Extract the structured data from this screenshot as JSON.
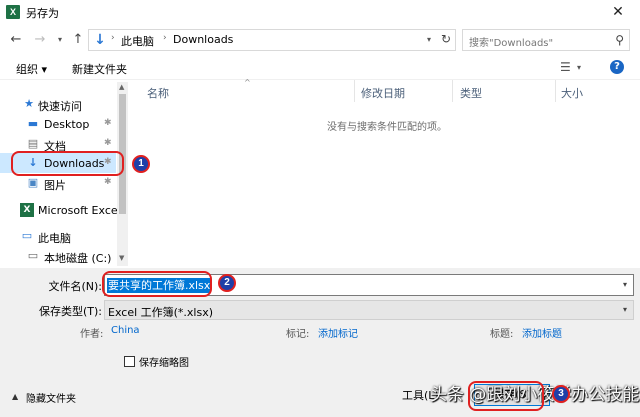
{
  "window": {
    "title": "另存为",
    "app_icon": "excel-icon",
    "close_glyph": "✕"
  },
  "address": {
    "crumbs": [
      "此电脑",
      "Downloads"
    ],
    "search_placeholder": "搜索\"Downloads\""
  },
  "toolbar": {
    "organize": "组织 ▾",
    "new_folder": "新建文件夹",
    "help": "?"
  },
  "nav": {
    "items": [
      {
        "label": "快速访问",
        "icon": "star-icon"
      },
      {
        "label": "Desktop",
        "icon": "desktop-folder-icon"
      },
      {
        "label": "文档",
        "icon": "documents-icon"
      },
      {
        "label": "Downloads",
        "icon": "download-arrow-icon"
      },
      {
        "label": "图片",
        "icon": "pictures-icon"
      },
      {
        "label": "Microsoft Excel",
        "icon": "excel-icon"
      },
      {
        "label": "此电脑",
        "icon": "computer-icon"
      },
      {
        "label": "本地磁盘 (C:)",
        "icon": "drive-icon"
      }
    ]
  },
  "content": {
    "columns": [
      "名称",
      "修改日期",
      "类型",
      "大小"
    ],
    "empty_message": "没有与搜索条件匹配的项。"
  },
  "form": {
    "filename_label": "文件名(N):",
    "filename_value": "要共享的工作簿.xlsx",
    "filetype_label": "保存类型(T):",
    "filetype_value": "Excel 工作簿(*.xlsx)",
    "author_label": "作者:",
    "author_value": "China",
    "tags_label": "标记:",
    "tags_value": "添加标记",
    "title_label": "标题:",
    "title_value": "添加标题",
    "thumbnail_label": "保存缩略图"
  },
  "footer": {
    "hide_folders": "隐藏文件夹",
    "tools": "工具(L)",
    "save": "保存(S)"
  },
  "annotations": {
    "badge1": "1",
    "badge2": "2",
    "badge3": "3"
  },
  "watermark": "头条 @跟刘小筱学办公技能",
  "colors": {
    "selection": "#0078d7",
    "nav_selected": "#cce8ff",
    "annotation_red": "#e02020",
    "badge_blue": "#1f3fa8"
  }
}
